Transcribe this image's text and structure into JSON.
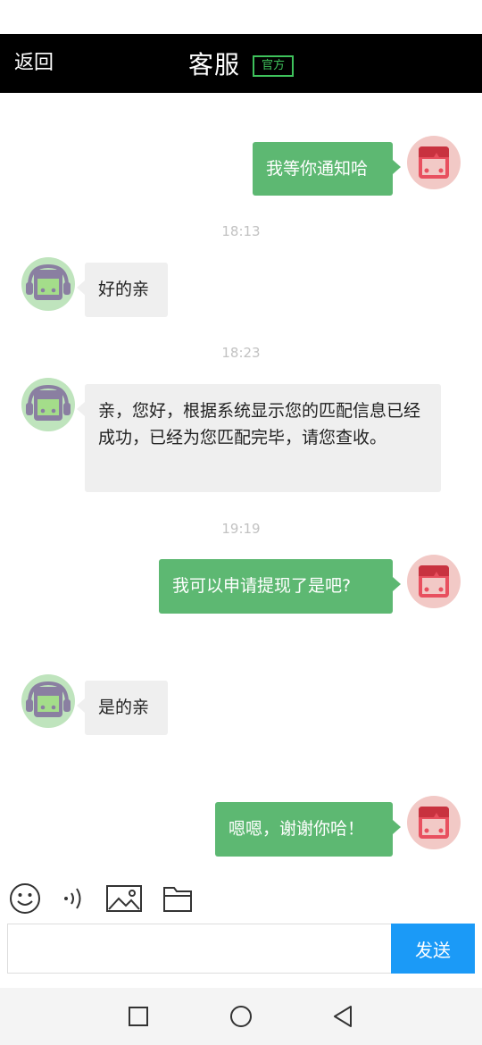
{
  "header": {
    "back_label": "返回",
    "title": "客服",
    "badge": "官方"
  },
  "messages": [
    {
      "from": "me",
      "text": "我等你通知哈"
    },
    {
      "time": "18:13"
    },
    {
      "from": "agent",
      "text": "好的亲"
    },
    {
      "time": "18:23"
    },
    {
      "from": "agent",
      "text": "亲，您好，根据系统显示您的匹配信息已经成功，已经为您匹配完毕，请您查收。"
    },
    {
      "time": "19:19"
    },
    {
      "from": "me",
      "text": "我可以申请提现了是吧?"
    },
    {
      "from": "agent",
      "text": "是的亲"
    },
    {
      "from": "me",
      "text": "嗯嗯，谢谢你哈！"
    }
  ],
  "toolbar": {
    "icons": [
      "emoji-icon",
      "voice-icon",
      "image-icon",
      "folder-icon"
    ]
  },
  "input": {
    "value": "",
    "placeholder": ""
  },
  "send_label": "发送",
  "nav": {
    "icons": [
      "recent-apps-icon",
      "home-icon",
      "back-icon"
    ]
  },
  "colors": {
    "header_bg": "#000000",
    "badge": "#3ec15b",
    "my_bubble": "#5db872",
    "agent_bubble": "#efefef",
    "send_button": "#1b9af7"
  }
}
